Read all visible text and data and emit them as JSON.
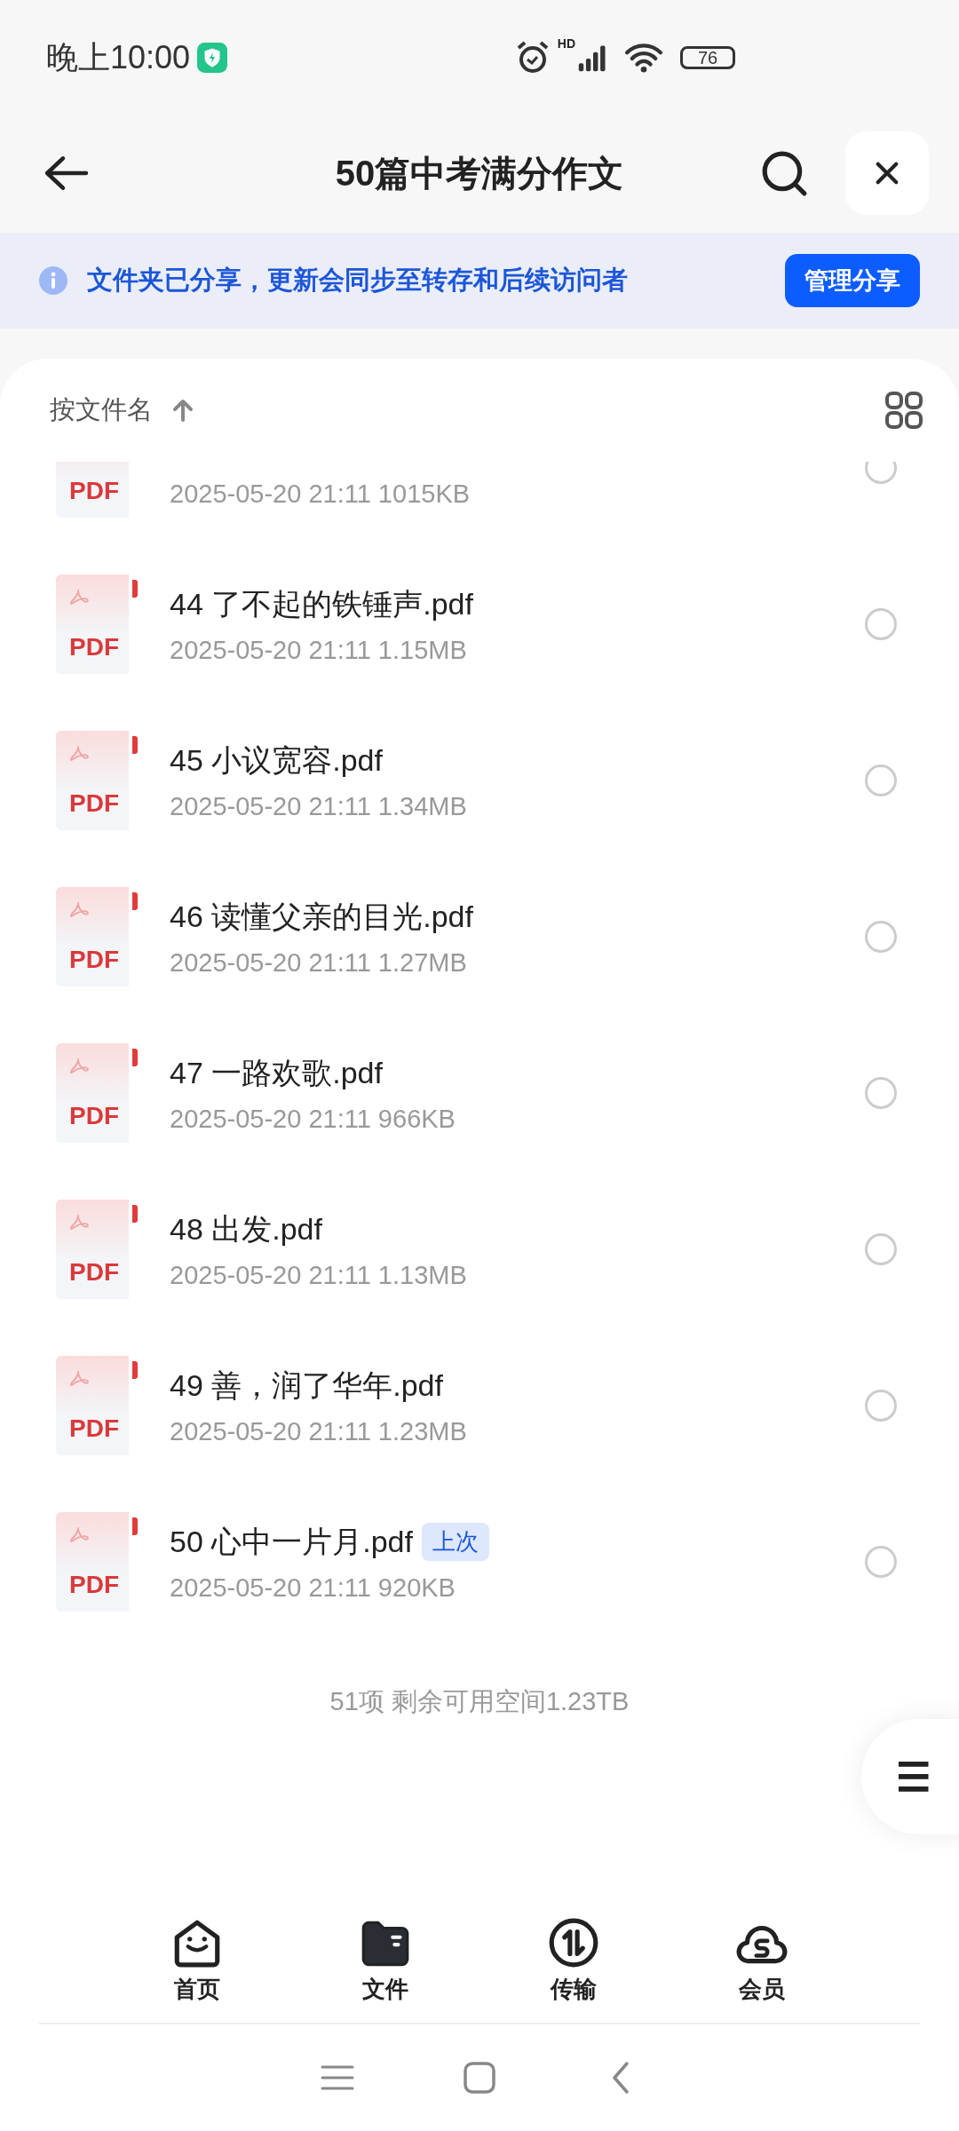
{
  "status_bar": {
    "time": "晚上10:00",
    "network": "HD",
    "battery": "76"
  },
  "header": {
    "title": "50篇中考满分作文"
  },
  "banner": {
    "text": "文件夹已分享，更新会同步至转存和后续访问者",
    "button": "管理分享"
  },
  "sort": {
    "label": "按文件名"
  },
  "files": [
    {
      "icon_label": "PDF",
      "meta": "2025-05-20 21:11  1015KB",
      "checked": false
    },
    {
      "icon_label": "PDF",
      "name": "44 了不起的铁锤声.pdf",
      "meta": "2025-05-20 21:11  1.15MB",
      "checked": false
    },
    {
      "icon_label": "PDF",
      "name": "45 小议宽容.pdf",
      "meta": "2025-05-20 21:11  1.34MB",
      "checked": false
    },
    {
      "icon_label": "PDF",
      "name": "46 读懂父亲的目光.pdf",
      "meta": "2025-05-20 21:11  1.27MB",
      "checked": false
    },
    {
      "icon_label": "PDF",
      "name": "47 一路欢歌.pdf",
      "meta": "2025-05-20 21:11  966KB",
      "checked": false
    },
    {
      "icon_label": "PDF",
      "name": "48 出发.pdf",
      "meta": "2025-05-20 21:11  1.13MB",
      "checked": false
    },
    {
      "icon_label": "PDF",
      "name": "49 善，润了华年.pdf",
      "meta": "2025-05-20 21:11  1.23MB",
      "checked": false
    },
    {
      "icon_label": "PDF",
      "name": "50 心中一片月.pdf",
      "badge": "上次",
      "meta": "2025-05-20 21:11  920KB",
      "checked": false
    }
  ],
  "footer": "51项 剩余可用空间1.23TB",
  "floating_menu": "☰",
  "bottom_nav": [
    {
      "kind": "home",
      "label": "首页",
      "selected": false
    },
    {
      "kind": "files",
      "label": "文件",
      "selected": true
    },
    {
      "kind": "transfer",
      "label": "传输",
      "selected": false
    },
    {
      "kind": "vip",
      "label": "会员",
      "selected": false
    }
  ]
}
